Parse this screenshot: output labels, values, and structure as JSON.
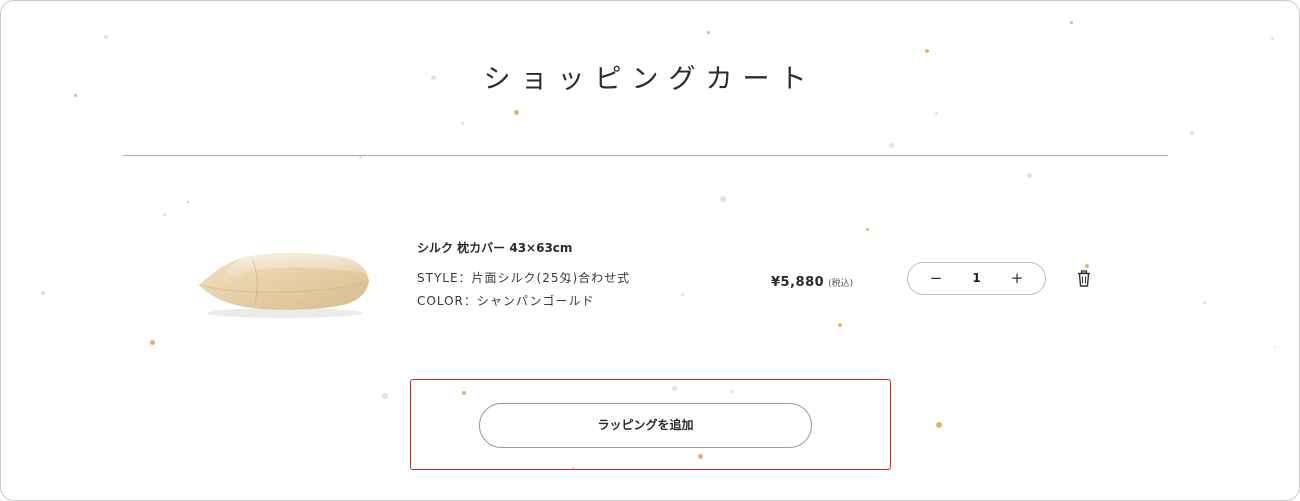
{
  "page": {
    "title": "ショッピングカート"
  },
  "cart_item": {
    "name": "シルク 枕カバー 43×63cm",
    "style_text": "STYLE：片面シルク(25匁)合わせ式",
    "color_text": "COLOR：シャンパンゴールド",
    "price": "¥5,880",
    "tax_note": "(税込)",
    "quantity": "1",
    "decrement_symbol": "−",
    "increment_symbol": "+",
    "delete_icon": "trash-icon",
    "image_alt": "champagne gold silk pillow"
  },
  "actions": {
    "add_wrapping_label": "ラッピングを追加"
  },
  "colors": {
    "accent_gold": "#e3b465",
    "highlight_red": "#e02020",
    "pillow": "#e8d3ad"
  }
}
